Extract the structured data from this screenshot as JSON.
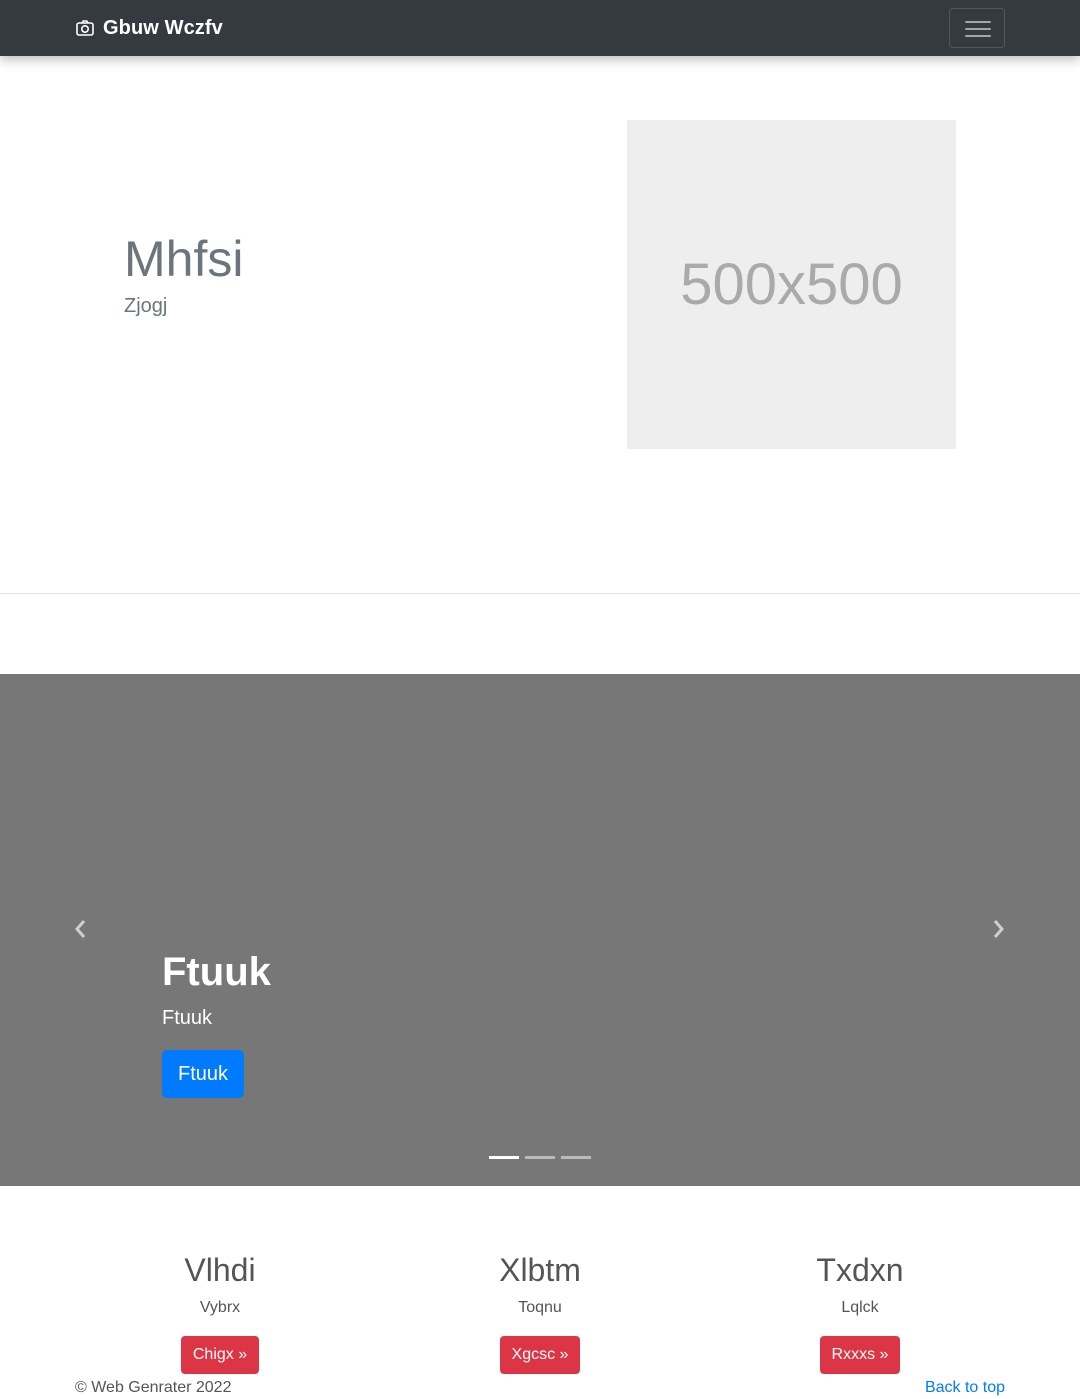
{
  "navbar": {
    "brand": "Gbuw Wczfv",
    "brand_icon": "camera-icon",
    "toggler_icon": "hamburger-menu-icon"
  },
  "hero": {
    "title": "Mhfsi",
    "subtitle": "Zjogj",
    "placeholder_text": "500x500"
  },
  "carousel": {
    "prev_icon": "chevron-left-icon",
    "next_icon": "chevron-right-icon",
    "caption_title": "Ftuuk",
    "caption_text": "Ftuuk",
    "caption_button": "Ftuuk",
    "slide_count": 3,
    "active_slide": 1
  },
  "columns": [
    {
      "heading": "Vlhdi",
      "text": "Vybrx",
      "button": "Chigx »"
    },
    {
      "heading": "Xlbtm",
      "text": "Toqnu",
      "button": "Xgcsc »"
    },
    {
      "heading": "Txdxn",
      "text": "Lqlck",
      "button": "Rxxxs »"
    }
  ],
  "footer": {
    "copyright": "© Web Genrater 2022",
    "back_to_top": "Back to top"
  },
  "colors": {
    "navbar_bg": "#343a40",
    "carousel_bg": "#777777",
    "primary": "#007bff",
    "danger": "#dc3545",
    "placeholder_bg": "#eeeeee"
  }
}
